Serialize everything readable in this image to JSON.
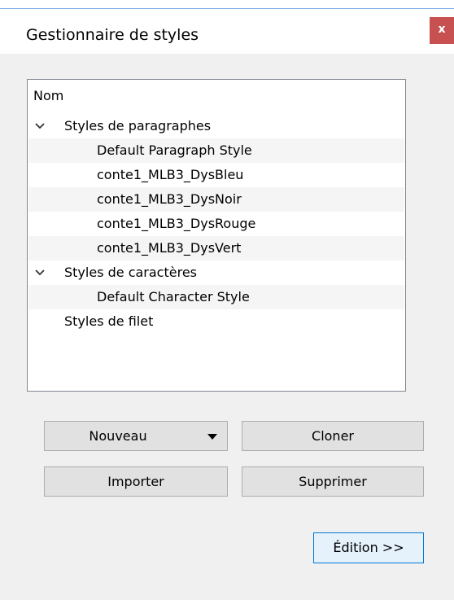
{
  "window": {
    "title": "Gestionnaire de styles",
    "close_label": "x",
    "accent_color": "#c75050"
  },
  "tree": {
    "header": "Nom",
    "rows": [
      {
        "label": "Styles de paragraphes",
        "level": 0,
        "expanded": true,
        "icon": "chevron-down-icon"
      },
      {
        "label": "Default Paragraph Style",
        "level": 1
      },
      {
        "label": "conte1_MLB3_DysBleu",
        "level": 1
      },
      {
        "label": "conte1_MLB3_DysNoir",
        "level": 1
      },
      {
        "label": "conte1_MLB3_DysRouge",
        "level": 1
      },
      {
        "label": "conte1_MLB3_DysVert",
        "level": 1
      },
      {
        "label": "Styles de caractères",
        "level": 0,
        "expanded": true,
        "icon": "chevron-down-icon"
      },
      {
        "label": "Default Character Style",
        "level": 1
      },
      {
        "label": "Styles de filet",
        "level": 0,
        "expanded": false
      }
    ]
  },
  "buttons": {
    "nouveau": "Nouveau",
    "cloner": "Cloner",
    "importer": "Importer",
    "supprimer": "Supprimer",
    "edition": "Édition >>"
  }
}
